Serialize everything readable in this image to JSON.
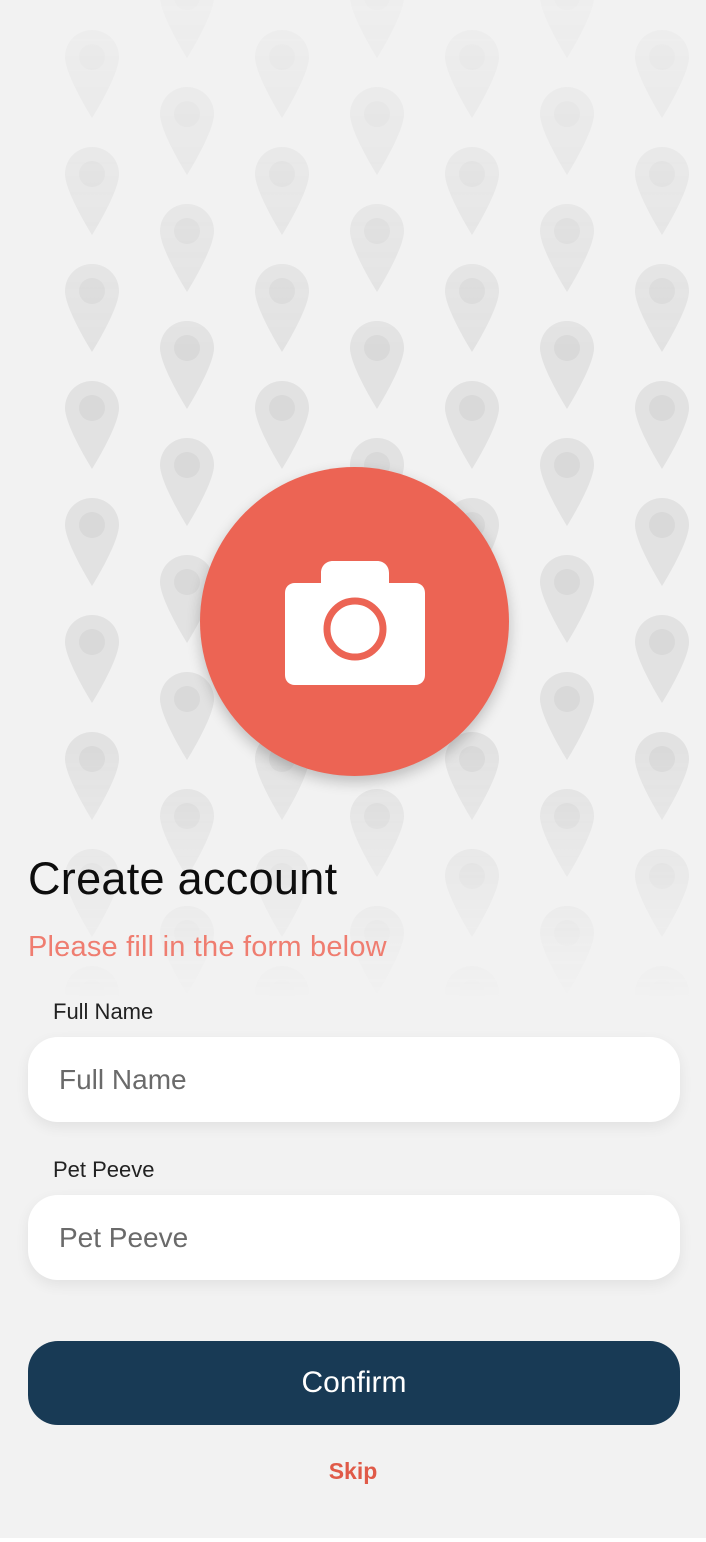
{
  "colors": {
    "background": "#f2f2f2",
    "accent": "#ec6454",
    "subtitle": "#ef7d70",
    "primary_button": "#183a55",
    "skip_link": "#e05a48"
  },
  "background_pattern_icon": "map-pin-icon",
  "avatar": {
    "icon": "camera-icon"
  },
  "header": {
    "title": "Create account",
    "subtitle": "Please fill in the form below"
  },
  "form": {
    "full_name": {
      "label": "Full Name",
      "placeholder": "Full Name",
      "value": ""
    },
    "pet_peeve": {
      "label": "Pet Peeve",
      "placeholder": "Pet Peeve",
      "value": ""
    }
  },
  "actions": {
    "confirm_label": "Confirm",
    "skip_label": "Skip"
  }
}
